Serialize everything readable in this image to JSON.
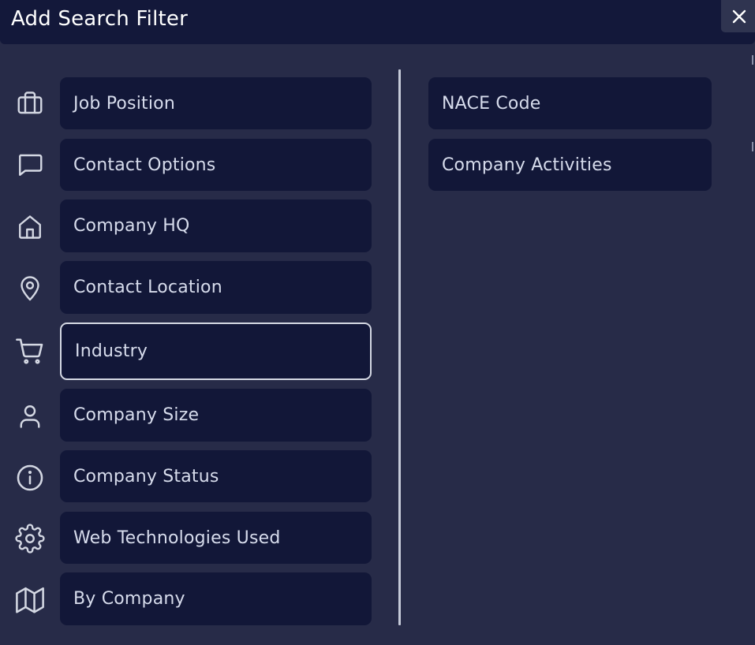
{
  "dialog": {
    "title": "Add Search Filter",
    "close_icon": "close-icon"
  },
  "left_filters": [
    {
      "label": "Job Position",
      "icon": "briefcase-icon"
    },
    {
      "label": "Contact Options",
      "icon": "chat-bubble-icon"
    },
    {
      "label": "Company HQ",
      "icon": "home-icon"
    },
    {
      "label": "Contact Location",
      "icon": "map-pin-icon"
    },
    {
      "label": "Industry",
      "icon": "shopping-cart-icon",
      "selected": true
    },
    {
      "label": "Company Size",
      "icon": "user-icon"
    },
    {
      "label": "Company Status",
      "icon": "info-icon"
    },
    {
      "label": "Web Technologies Used",
      "icon": "gear-icon"
    },
    {
      "label": "By Company",
      "icon": "map-icon"
    }
  ],
  "right_filters": [
    {
      "label": "NACE Code"
    },
    {
      "label": "Company Activities"
    }
  ],
  "colors": {
    "background": "#272b48",
    "header": "#13183a",
    "button": "#121738",
    "selected_border": "#d4d8e3",
    "text": "#d7dcec"
  }
}
